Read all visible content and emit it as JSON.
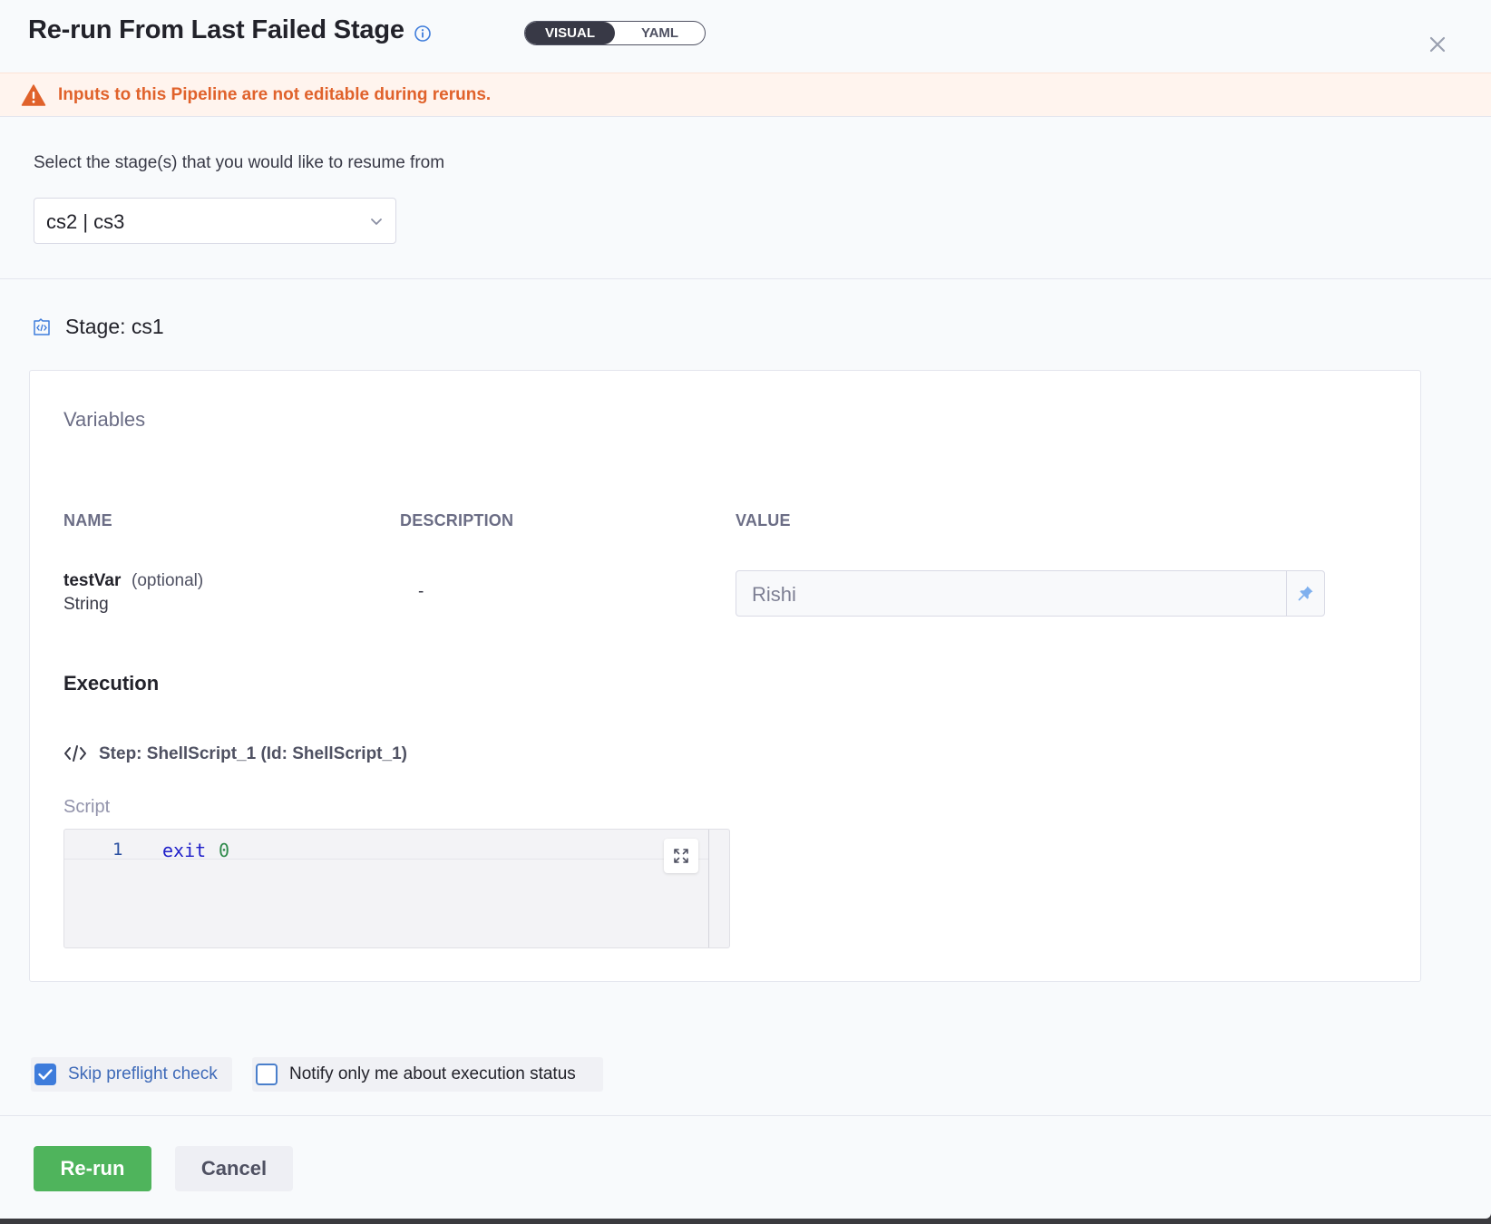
{
  "header": {
    "title": "Re-run From Last Failed Stage",
    "view_toggle": {
      "visual_label": "VISUAL",
      "yaml_label": "YAML",
      "active": "VISUAL"
    }
  },
  "warning": {
    "text": "Inputs to this Pipeline are not editable during reruns."
  },
  "stage_selector": {
    "label": "Select the stage(s) that you would like to resume from",
    "value": "cs2 | cs3"
  },
  "stage": {
    "title": "Stage: cs1",
    "variables": {
      "heading": "Variables",
      "columns": [
        "NAME",
        "DESCRIPTION",
        "VALUE"
      ],
      "rows": [
        {
          "name": "testVar",
          "optional": "(optional)",
          "type": "String",
          "description": "-",
          "value": "Rishi"
        }
      ]
    },
    "execution": {
      "heading": "Execution",
      "step_title": "Step: ShellScript_1 (Id: ShellScript_1)",
      "script_label": "Script",
      "script_lines": [
        {
          "number": "1",
          "keyword": "exit",
          "arg": "0"
        }
      ]
    }
  },
  "options": {
    "skip_preflight": {
      "label": "Skip preflight check",
      "checked": true
    },
    "notify_only_me": {
      "label": "Notify only me about execution status",
      "checked": false
    }
  },
  "footer": {
    "rerun_label": "Re-run",
    "cancel_label": "Cancel"
  },
  "colors": {
    "accent": "#3e7cdb",
    "warning": "#e0622b",
    "primary_button": "#4fb45c",
    "toggle_active": "#383946"
  }
}
